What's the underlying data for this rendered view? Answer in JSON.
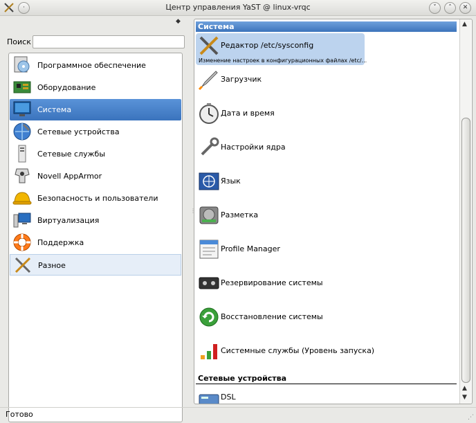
{
  "window": {
    "title": "Центр управления YaST @ linux-vrqc",
    "buttons": [
      "chevron-down-icon",
      "chevron-up-icon",
      "close-icon"
    ]
  },
  "left": {
    "search_label": "Поиск",
    "search_value": "",
    "categories": [
      {
        "label": "Программное обеспечение",
        "icon": "software-icon"
      },
      {
        "label": "Оборудование",
        "icon": "hardware-icon"
      },
      {
        "label": "Система",
        "icon": "system-monitor-icon"
      },
      {
        "label": "Сетевые устройства",
        "icon": "network-devices-icon"
      },
      {
        "label": "Сетевые службы",
        "icon": "network-services-icon"
      },
      {
        "label": "Novell AppArmor",
        "icon": "apparmor-icon"
      },
      {
        "label": "Безопасность и пользователи",
        "icon": "security-helmet-icon"
      },
      {
        "label": "Виртуализация",
        "icon": "virtualization-icon"
      },
      {
        "label": "Поддержка",
        "icon": "lifebuoy-icon"
      },
      {
        "label": "Разное",
        "icon": "misc-tools-icon"
      }
    ],
    "selected_index": 2,
    "hover_index": 9
  },
  "right": {
    "section1": "Система",
    "modules": [
      {
        "label": "Редактор /etc/sysconfig",
        "desc": "Изменение настроек в конфигурационных файлах /etc/...",
        "icon": "tools-icon"
      },
      {
        "label": "Загрузчик",
        "icon": "rocket-icon"
      },
      {
        "label": "Дата и время",
        "icon": "clock-icon"
      },
      {
        "label": "Настройки ядра",
        "icon": "wrench-icon"
      },
      {
        "label": "Язык",
        "icon": "language-icon"
      },
      {
        "label": "Разметка",
        "icon": "harddisk-icon"
      },
      {
        "label": "Profile Manager",
        "icon": "profile-manager-icon"
      },
      {
        "label": "Резервирование системы",
        "icon": "tape-backup-icon"
      },
      {
        "label": "Восстановление системы",
        "icon": "restore-icon"
      },
      {
        "label": "Системные службы (Уровень запуска)",
        "icon": "runlevel-icon"
      }
    ],
    "section2": "Сетевые устройства",
    "modules2": [
      {
        "label": "DSL",
        "icon": "dsl-modem-icon"
      }
    ]
  },
  "status": {
    "text": "Готово"
  },
  "colors": {
    "selection": "#3a73bd",
    "hover": "#e6eef8",
    "module_selected": "#bcd3ee"
  }
}
